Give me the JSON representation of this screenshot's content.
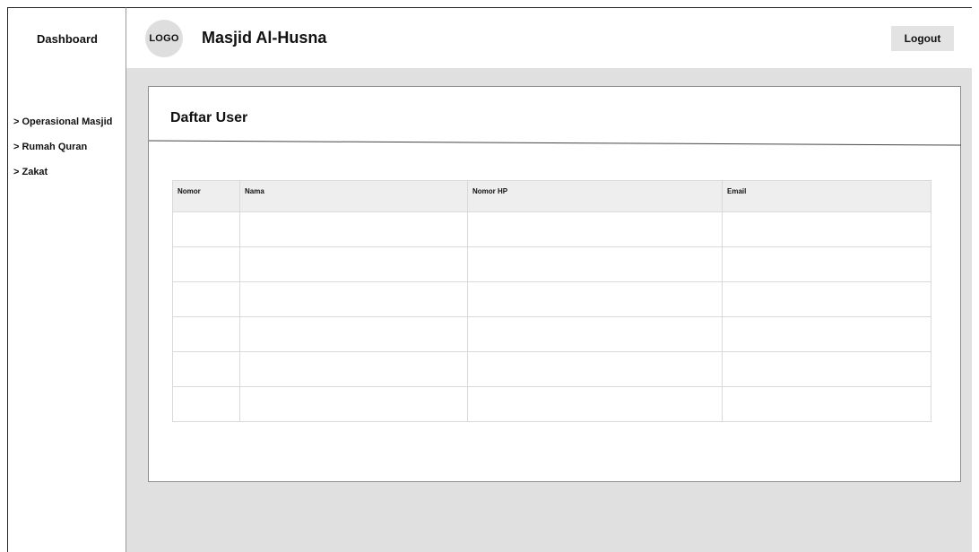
{
  "sidebar": {
    "title": "Dashboard",
    "items": [
      {
        "label": "> Operasional Masjid"
      },
      {
        "label": "> Rumah Quran"
      },
      {
        "label": "> Zakat"
      }
    ]
  },
  "header": {
    "logo_text": "LOGO",
    "title": "Masjid Al-Husna",
    "logout_label": "Logout"
  },
  "main": {
    "title": "Daftar User",
    "table": {
      "columns": [
        "Nomor",
        "Nama",
        "Nomor HP",
        "Email"
      ],
      "rows": [
        [
          "",
          "",
          "",
          ""
        ],
        [
          "",
          "",
          "",
          ""
        ],
        [
          "",
          "",
          "",
          ""
        ],
        [
          "",
          "",
          "",
          ""
        ],
        [
          "",
          "",
          "",
          ""
        ],
        [
          "",
          "",
          "",
          ""
        ]
      ]
    }
  },
  "colors": {
    "content_background": "#e0e0e0",
    "logo_background": "#dedede",
    "button_background": "#e3e3e3",
    "table_header_background": "#eeeeee"
  }
}
